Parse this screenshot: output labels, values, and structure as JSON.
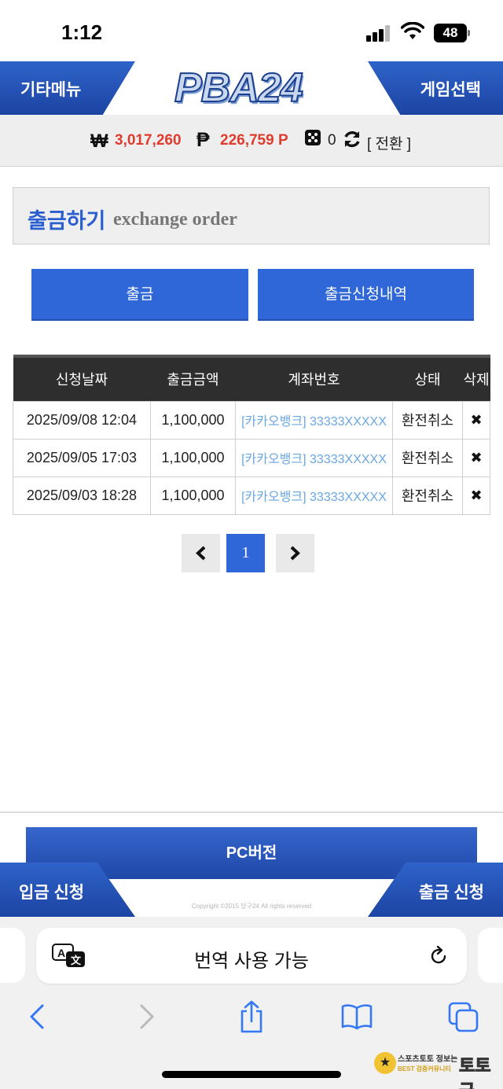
{
  "status_bar": {
    "time": "1:12",
    "battery": "48"
  },
  "header": {
    "left_menu": "기타메뉴",
    "logo": "PBA24",
    "right_menu": "게임선택"
  },
  "balance": {
    "money": "3,017,260",
    "points": "226,759 P",
    "dice_count": "0",
    "swap_label": "[ 전환 ]"
  },
  "title": {
    "korean": "출금하기",
    "english": "exchange order"
  },
  "actions": {
    "withdraw": "출금",
    "history": "출금신청내역"
  },
  "table": {
    "headers": [
      "신청날짜",
      "출금금액",
      "계좌번호",
      "상태",
      "삭제"
    ],
    "rows": [
      {
        "date": "2025/09/08 12:04",
        "amount": "1,100,000",
        "account": "[카카오뱅크] 33333XXXXX",
        "status": "환전취소",
        "delete": "✖"
      },
      {
        "date": "2025/09/05 17:03",
        "amount": "1,100,000",
        "account": "[카카오뱅크] 33333XXXXX",
        "status": "환전취소",
        "delete": "✖"
      },
      {
        "date": "2025/09/03 18:28",
        "amount": "1,100,000",
        "account": "[카카오뱅크] 33333XXXXX",
        "status": "환전취소",
        "delete": "✖"
      }
    ]
  },
  "pagination": {
    "current": "1"
  },
  "footer": {
    "pc_version": "PC버전",
    "deposit": "입금 신청",
    "withdraw": "출금 신청",
    "copyright": "Copyright ©2015 당구24 All rights reserved"
  },
  "browser": {
    "address_text": "번역 사용 가능"
  },
  "watermark": {
    "top": "스포츠토토 정보는",
    "bottom": "BEST 검증커뮤니티",
    "brand": "토토군"
  },
  "colors": {
    "accent_blue": "#2f66d8",
    "amount_red": "#e03c2e",
    "account_link": "#6aa7e3",
    "header_dark": "#2e2e2e"
  },
  "icons": [
    "won-icon",
    "peso-icon",
    "dice-icon",
    "refresh-icon",
    "delete-icon",
    "chevron-left-icon",
    "chevron-right-icon",
    "translate-icon",
    "reload-icon",
    "back-icon",
    "forward-icon",
    "share-icon",
    "bookmarks-icon",
    "tabs-icon"
  ]
}
